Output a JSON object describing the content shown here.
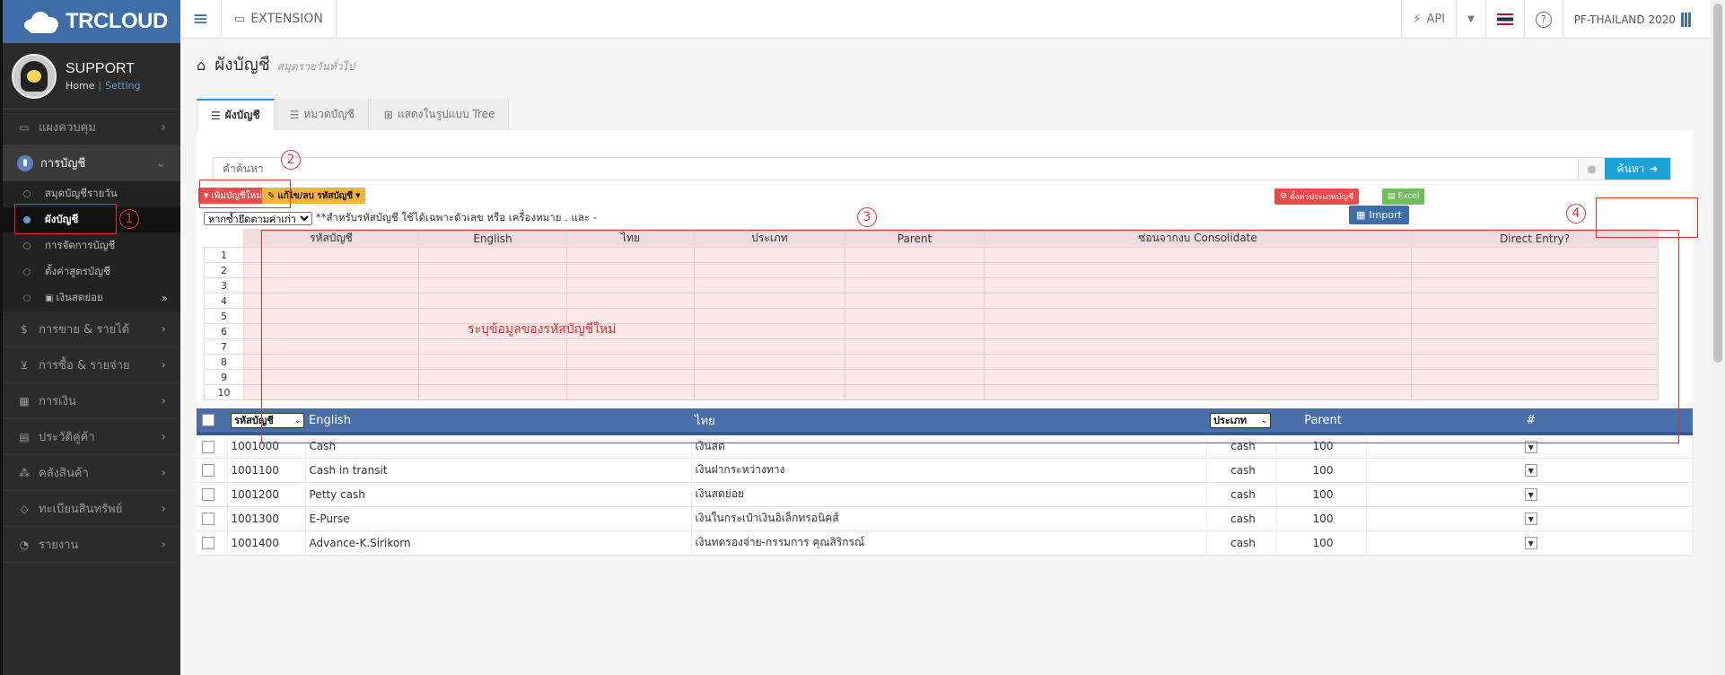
{
  "app": {
    "logo": "TRCLOUD"
  },
  "profile": {
    "name": "SUPPORT",
    "home": "Home",
    "separator": "|",
    "setting": "Setting"
  },
  "sidebar": {
    "items": [
      {
        "label": "แผงควบคุม",
        "icon": "monitor-icon"
      },
      {
        "label": "การบัญชี",
        "icon": "book-icon"
      },
      {
        "label": "การขาย & รายได้",
        "icon": "dollar-icon"
      },
      {
        "label": "การซื้อ & รายจ่าย",
        "icon": "cart-icon"
      },
      {
        "label": "การเงิน",
        "icon": "calendar-icon"
      },
      {
        "label": "ประวัติคู่ค้า",
        "icon": "contact-icon"
      },
      {
        "label": "คลังสินค้า",
        "icon": "cubes-icon"
      },
      {
        "label": "ทะเบียนสินทรัพย์",
        "icon": "diamond-icon"
      },
      {
        "label": "รายงาน",
        "icon": "report-icon"
      }
    ],
    "sub_items": [
      {
        "label": "สมุดบัญชีรายวัน"
      },
      {
        "label": "ผังบัญชี"
      },
      {
        "label": "การจัดการบัญชี"
      },
      {
        "label": "ตั้งค่าสูตรบัญชี"
      },
      {
        "label": "เงินสดย่อย"
      }
    ]
  },
  "topbar": {
    "extension": "EXTENSION",
    "api": "API",
    "company": "PF-THAILAND 2020"
  },
  "page": {
    "title": "ผังบัญชี",
    "subtitle": "สมุดรายวันทั่วไป"
  },
  "tabs": [
    {
      "label": "ผังบัญชี"
    },
    {
      "label": "หมวดบัญชี"
    },
    {
      "label": "แสดงในรูปแบบ Tree"
    }
  ],
  "search": {
    "placeholder": "คำค้นหา",
    "button": "ค้นหา"
  },
  "buttons": {
    "add": "เพิ่มบัญชีใหม่",
    "edit": "แก้ไข/ลบ รหัสบัญชี",
    "set_type": "ตั้งค่าประเภทบัญชี",
    "excel": "Excel",
    "import": "Import"
  },
  "note": {
    "select_value": "หากซ้ำยึดตามค่าเก่า",
    "text": "**สำหรับรหัสบัญชี ใช้ได้เฉพาะตัวเลข หรือ เครื่องหมาย . และ -"
  },
  "annotations": {
    "one": "1",
    "two": "2",
    "three": "3",
    "four": "4",
    "fill_hint": "ระบุข้อมูลของรหัสบัญชีใหม่"
  },
  "editor": {
    "columns": [
      "รหัสบัญชี",
      "English",
      "ไทย",
      "ประเภท",
      "Parent",
      "ซ่อนจากงบ Consolidate",
      "Direct Entry?"
    ],
    "rows": [
      "1",
      "2",
      "3",
      "4",
      "5",
      "6",
      "7",
      "8",
      "9",
      "10"
    ]
  },
  "list": {
    "headers": {
      "code": "รหัสบัญชี",
      "english": "English",
      "thai": "ไทย",
      "type": "ประเภท",
      "parent": "Parent",
      "hash": "#"
    },
    "rows": [
      {
        "code": "1001000",
        "english": "Cash",
        "thai": "เงินสด",
        "type": "cash",
        "parent": "100"
      },
      {
        "code": "1001100",
        "english": "Cash in transit",
        "thai": "เงินฝากระหว่างทาง",
        "type": "cash",
        "parent": "100"
      },
      {
        "code": "1001200",
        "english": "Petty cash",
        "thai": "เงินสดย่อย",
        "type": "cash",
        "parent": "100"
      },
      {
        "code": "1001300",
        "english": "E-Purse",
        "thai": "เงินในกระเป๋าเงินอิเล็กทรอนิคส์",
        "type": "cash",
        "parent": "100"
      },
      {
        "code": "1001400",
        "english": "Advance-K.Sirikorn",
        "thai": "เงินทดรองจ่าย-กรรมการ คุณสิริกรณ์",
        "type": "cash",
        "parent": "100"
      }
    ]
  },
  "colors": {
    "brand": "#3d6ea8",
    "sidebar": "#2b2b2b",
    "highlight": "#e03030",
    "search_button": "#1aa3d9",
    "table_header": "#4a6ea8"
  }
}
